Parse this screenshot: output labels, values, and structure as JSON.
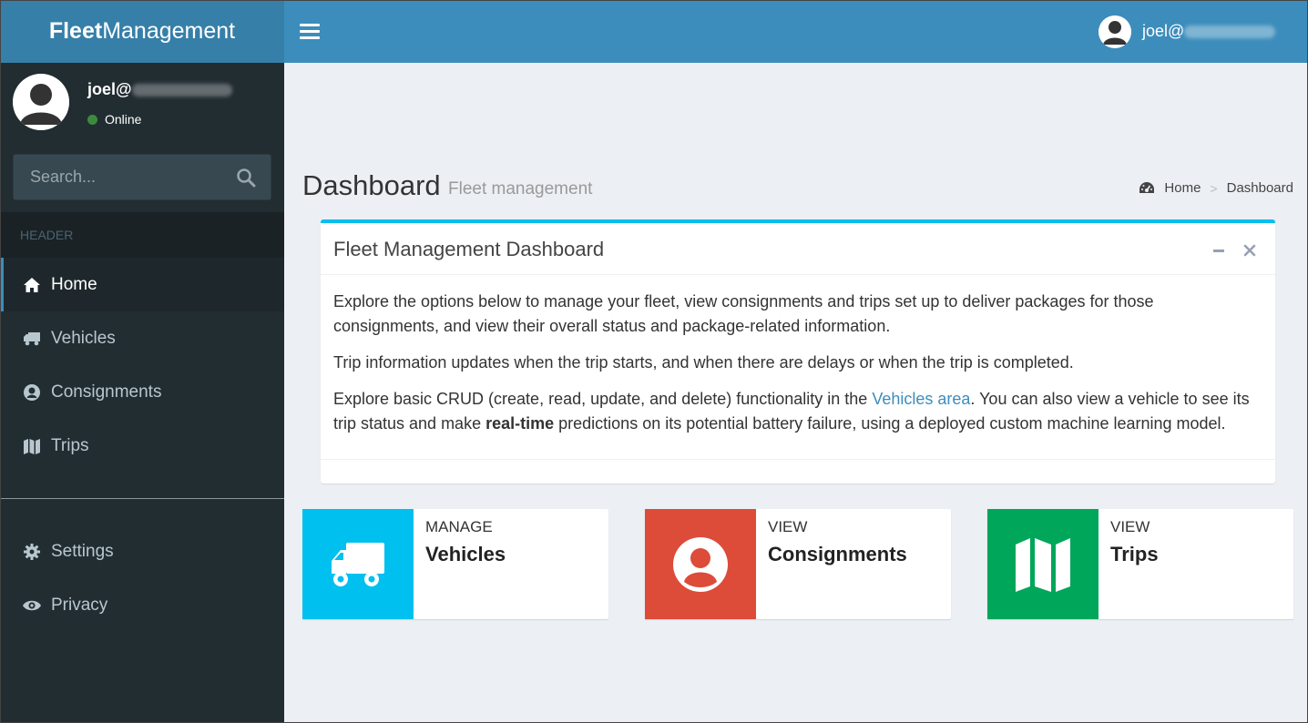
{
  "brand": {
    "bold": "Fleet",
    "rest": "Management"
  },
  "topbar": {
    "user_visible": "joel@"
  },
  "user_panel": {
    "name_visible": "joel@",
    "status": "Online"
  },
  "search": {
    "placeholder": "Search..."
  },
  "sidebar": {
    "header": "HEADER",
    "items": [
      {
        "label": "Home",
        "icon": "home-icon",
        "active": true
      },
      {
        "label": "Vehicles",
        "icon": "truck-icon"
      },
      {
        "label": "Consignments",
        "icon": "user-circle-icon"
      },
      {
        "label": "Trips",
        "icon": "map-icon"
      }
    ],
    "bottom_items": [
      {
        "label": "Settings",
        "icon": "gear-icon"
      },
      {
        "label": "Privacy",
        "icon": "eye-icon"
      }
    ]
  },
  "page": {
    "title": "Dashboard",
    "subtitle": "Fleet management"
  },
  "breadcrumb": {
    "home": "Home",
    "current": "Dashboard"
  },
  "box": {
    "title": "Fleet Management Dashboard",
    "p1": "Explore the options below to manage your fleet, view consignments and trips set up to deliver packages for those consignments, and view their overall status and package-related information.",
    "p2": "Trip information updates when the trip starts, and when there are delays or when the trip is completed.",
    "p3_before": "Explore basic CRUD (create, read, update, and delete) functionality in the ",
    "p3_link": "Vehicles area",
    "p3_middle": ". You can also view a vehicle to see its trip status and make ",
    "p3_bold": "real-time",
    "p3_after": " predictions on its potential battery failure, using a deployed custom machine learning model."
  },
  "info_boxes": [
    {
      "text": "MANAGE",
      "number": "Vehicles",
      "color": "#00c0ef",
      "icon": "truck-icon"
    },
    {
      "text": "VIEW",
      "number": "Consignments",
      "color": "#dd4b39",
      "icon": "user-circle-icon"
    },
    {
      "text": "VIEW",
      "number": "Trips",
      "color": "#00a65a",
      "icon": "map-icon"
    }
  ],
  "colors": {
    "topbar": "#3c8dbc",
    "logo": "#367fa9",
    "sidebar": "#222d32",
    "box_accent": "#00c0ef"
  }
}
